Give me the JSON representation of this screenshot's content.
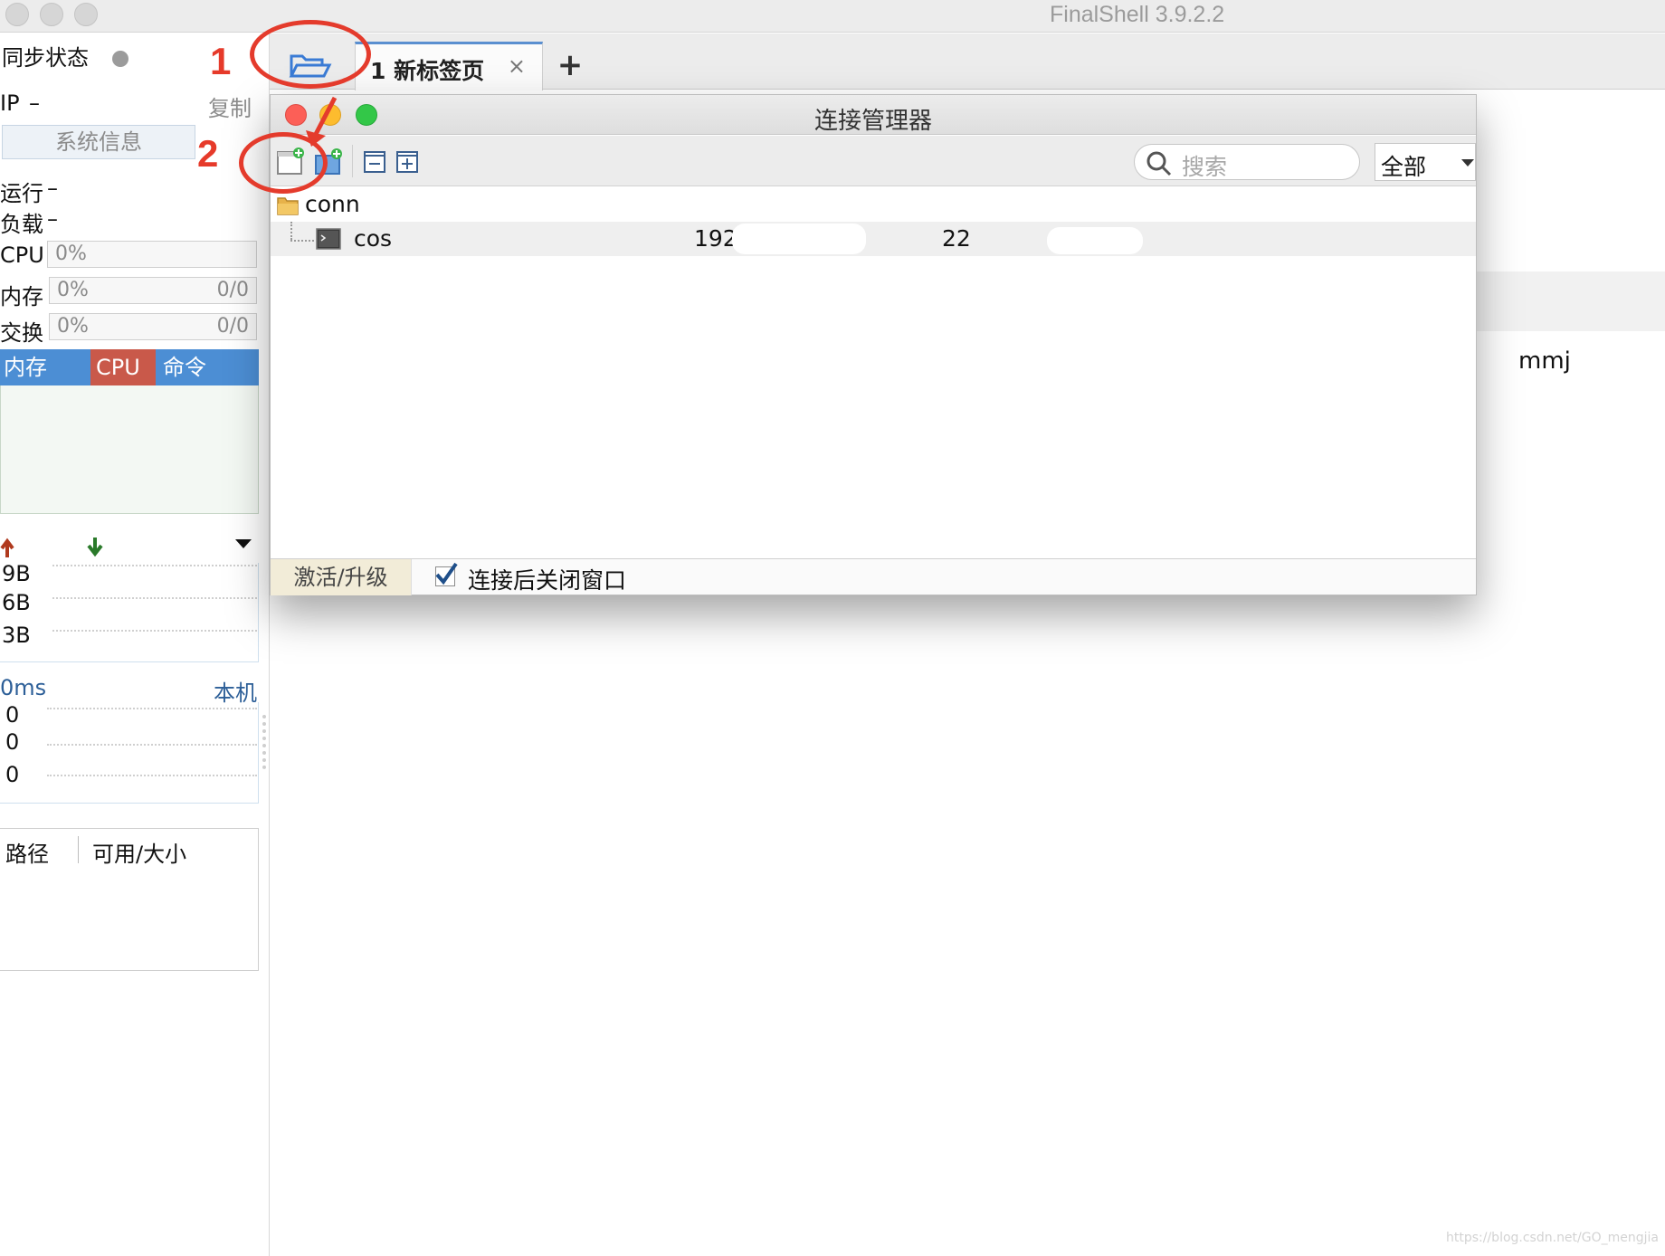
{
  "app": {
    "title": "FinalShell 3.9.2.2"
  },
  "sidebar": {
    "sync_label": "同步状态",
    "ip_label": "IP",
    "ip_value": "–",
    "copy_label": "复制",
    "sysinfo_label": "系统信息",
    "uptime_label": "运行",
    "uptime_value": "–",
    "load_label": "负载",
    "load_value": "–",
    "cpu_label": "CPU",
    "cpu_value": "0%",
    "mem_label": "内存",
    "mem_value": "0%",
    "mem_amount": "0/0",
    "swap_label": "交换",
    "swap_value": "0%",
    "swap_amount": "0/0",
    "process_tabs": [
      "内存",
      "CPU",
      "命令"
    ],
    "net_rates": [
      "9B",
      "6B",
      "3B"
    ],
    "latency_label": "0ms",
    "latency_host": "本机",
    "latency_values": [
      "0",
      "0",
      "0"
    ],
    "disk_columns": [
      "路径",
      "可用/大小"
    ]
  },
  "tabs": {
    "active_label": "1  新标签页",
    "close_glyph": "×",
    "add_glyph": "+"
  },
  "background": {
    "user_text": "mmj",
    "watermark": "https://blog.csdn.net/GO_mengjia"
  },
  "annotations": [
    "1",
    "2"
  ],
  "dialog": {
    "title": "连接管理器",
    "search_placeholder": "搜索",
    "filter_value": "全部",
    "tree": {
      "folder_name": "conn",
      "connections": [
        {
          "name": "cos",
          "host": "192",
          "port": "22"
        }
      ]
    },
    "footer": {
      "activate_label": "激活/升级",
      "close_after_connect_label": "连接后关闭窗口",
      "close_after_connect_checked": true
    }
  },
  "colors": {
    "accent_blue": "#4c8ed4",
    "cpu_tab": "#c9594a",
    "annotation_red": "#e43b2c",
    "close_red": "#fc5f57",
    "minimize_yellow": "#fdbc2e",
    "zoom_green": "#33c748"
  },
  "icons": [
    "folder-open-icon",
    "new-connection-icon",
    "new-folder-icon",
    "collapse-all-icon",
    "expand-all-icon",
    "search-icon",
    "terminal-icon",
    "folder-icon",
    "upload-arrow-icon",
    "download-arrow-icon",
    "dropdown-icon"
  ]
}
